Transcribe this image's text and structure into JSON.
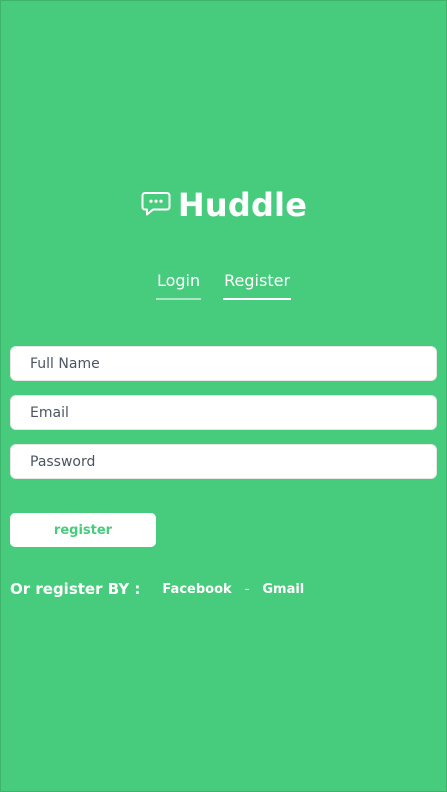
{
  "brand": {
    "name": "Huddle",
    "icon": "chat-bubble-icon",
    "color": "#ffffff"
  },
  "tabs": {
    "login": "Login",
    "register": "Register",
    "active": "Register"
  },
  "form": {
    "full_name": {
      "placeholder": "Full Name",
      "value": ""
    },
    "email": {
      "placeholder": "Email",
      "value": ""
    },
    "password": {
      "placeholder": "Password",
      "value": ""
    },
    "submit_label": "register"
  },
  "social": {
    "prefix": "Or register BY :",
    "facebook": "Facebook",
    "separator": "-",
    "gmail": "Gmail"
  },
  "colors": {
    "background": "#47cb7d",
    "surface": "#ffffff",
    "accent": "#47cb7d"
  }
}
